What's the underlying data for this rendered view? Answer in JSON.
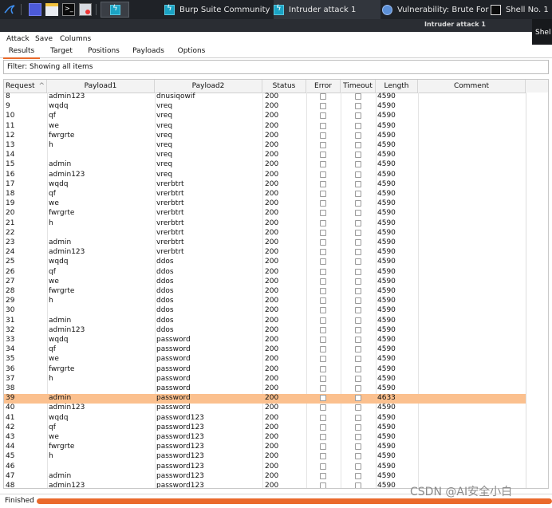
{
  "taskbar": {
    "tasks": [
      {
        "label": "Burp Suite Community E..."
      },
      {
        "label": "Intruder attack 1"
      },
      {
        "label": "Vulnerability: Brute Forc..."
      },
      {
        "label": "Shell No. 1"
      }
    ]
  },
  "window": {
    "title": "Intruder attack 1",
    "side_tab": "Shel"
  },
  "menu": {
    "items": [
      "Attack",
      "Save",
      "Columns"
    ]
  },
  "tabs": [
    "Results",
    "Target",
    "Positions",
    "Payloads",
    "Options"
  ],
  "active_tab": "Results",
  "filter": {
    "text": "Filter: Showing all items"
  },
  "table": {
    "columns": [
      "Request",
      "Payload1",
      "Payload2",
      "Status",
      "Error",
      "Timeout",
      "Length",
      "Comment"
    ],
    "sort_indicator": "^",
    "rows": [
      {
        "request": "8",
        "payload1": "admin123",
        "payload2": "dnusiqowif",
        "status": "200",
        "length": "4590"
      },
      {
        "request": "9",
        "payload1": "wqdq",
        "payload2": "vreq",
        "status": "200",
        "length": "4590"
      },
      {
        "request": "10",
        "payload1": "qf",
        "payload2": "vreq",
        "status": "200",
        "length": "4590"
      },
      {
        "request": "11",
        "payload1": "we",
        "payload2": "vreq",
        "status": "200",
        "length": "4590"
      },
      {
        "request": "12",
        "payload1": "fwrgrte",
        "payload2": "vreq",
        "status": "200",
        "length": "4590"
      },
      {
        "request": "13",
        "payload1": "h",
        "payload2": "vreq",
        "status": "200",
        "length": "4590"
      },
      {
        "request": "14",
        "payload1": "",
        "payload2": "vreq",
        "status": "200",
        "length": "4590"
      },
      {
        "request": "15",
        "payload1": "admin",
        "payload2": "vreq",
        "status": "200",
        "length": "4590"
      },
      {
        "request": "16",
        "payload1": "admin123",
        "payload2": "vreq",
        "status": "200",
        "length": "4590"
      },
      {
        "request": "17",
        "payload1": "wqdq",
        "payload2": "vrerbtrt",
        "status": "200",
        "length": "4590"
      },
      {
        "request": "18",
        "payload1": "qf",
        "payload2": "vrerbtrt",
        "status": "200",
        "length": "4590"
      },
      {
        "request": "19",
        "payload1": "we",
        "payload2": "vrerbtrt",
        "status": "200",
        "length": "4590"
      },
      {
        "request": "20",
        "payload1": "fwrgrte",
        "payload2": "vrerbtrt",
        "status": "200",
        "length": "4590"
      },
      {
        "request": "21",
        "payload1": "h",
        "payload2": "vrerbtrt",
        "status": "200",
        "length": "4590"
      },
      {
        "request": "22",
        "payload1": "",
        "payload2": "vrerbtrt",
        "status": "200",
        "length": "4590"
      },
      {
        "request": "23",
        "payload1": "admin",
        "payload2": "vrerbtrt",
        "status": "200",
        "length": "4590"
      },
      {
        "request": "24",
        "payload1": "admin123",
        "payload2": "vrerbtrt",
        "status": "200",
        "length": "4590"
      },
      {
        "request": "25",
        "payload1": "wqdq",
        "payload2": "ddos",
        "status": "200",
        "length": "4590"
      },
      {
        "request": "26",
        "payload1": "qf",
        "payload2": "ddos",
        "status": "200",
        "length": "4590"
      },
      {
        "request": "27",
        "payload1": "we",
        "payload2": "ddos",
        "status": "200",
        "length": "4590"
      },
      {
        "request": "28",
        "payload1": "fwrgrte",
        "payload2": "ddos",
        "status": "200",
        "length": "4590"
      },
      {
        "request": "29",
        "payload1": "h",
        "payload2": "ddos",
        "status": "200",
        "length": "4590"
      },
      {
        "request": "30",
        "payload1": "",
        "payload2": "ddos",
        "status": "200",
        "length": "4590"
      },
      {
        "request": "31",
        "payload1": "admin",
        "payload2": "ddos",
        "status": "200",
        "length": "4590"
      },
      {
        "request": "32",
        "payload1": "admin123",
        "payload2": "ddos",
        "status": "200",
        "length": "4590"
      },
      {
        "request": "33",
        "payload1": "wqdq",
        "payload2": "password",
        "status": "200",
        "length": "4590"
      },
      {
        "request": "34",
        "payload1": "qf",
        "payload2": "password",
        "status": "200",
        "length": "4590"
      },
      {
        "request": "35",
        "payload1": "we",
        "payload2": "password",
        "status": "200",
        "length": "4590"
      },
      {
        "request": "36",
        "payload1": "fwrgrte",
        "payload2": "password",
        "status": "200",
        "length": "4590"
      },
      {
        "request": "37",
        "payload1": "h",
        "payload2": "password",
        "status": "200",
        "length": "4590"
      },
      {
        "request": "38",
        "payload1": "",
        "payload2": "password",
        "status": "200",
        "length": "4590"
      },
      {
        "request": "39",
        "payload1": "admin",
        "payload2": "password",
        "status": "200",
        "length": "4633",
        "selected": true
      },
      {
        "request": "40",
        "payload1": "admin123",
        "payload2": "password",
        "status": "200",
        "length": "4590"
      },
      {
        "request": "41",
        "payload1": "wqdq",
        "payload2": "password123",
        "status": "200",
        "length": "4590"
      },
      {
        "request": "42",
        "payload1": "qf",
        "payload2": "password123",
        "status": "200",
        "length": "4590"
      },
      {
        "request": "43",
        "payload1": "we",
        "payload2": "password123",
        "status": "200",
        "length": "4590"
      },
      {
        "request": "44",
        "payload1": "fwrgrte",
        "payload2": "password123",
        "status": "200",
        "length": "4590"
      },
      {
        "request": "45",
        "payload1": "h",
        "payload2": "password123",
        "status": "200",
        "length": "4590"
      },
      {
        "request": "46",
        "payload1": "",
        "payload2": "password123",
        "status": "200",
        "length": "4590"
      },
      {
        "request": "47",
        "payload1": "admin",
        "payload2": "password123",
        "status": "200",
        "length": "4590"
      },
      {
        "request": "48",
        "payload1": "admin123",
        "payload2": "password123",
        "status": "200",
        "length": "4590"
      }
    ]
  },
  "status": {
    "text": "Finished",
    "progress_percent": 100
  },
  "watermark": "CSDN @AI安全小白",
  "colors": {
    "accent": "#e8692a",
    "selected_row": "#fbc08e",
    "taskbar": "#1f2227"
  }
}
